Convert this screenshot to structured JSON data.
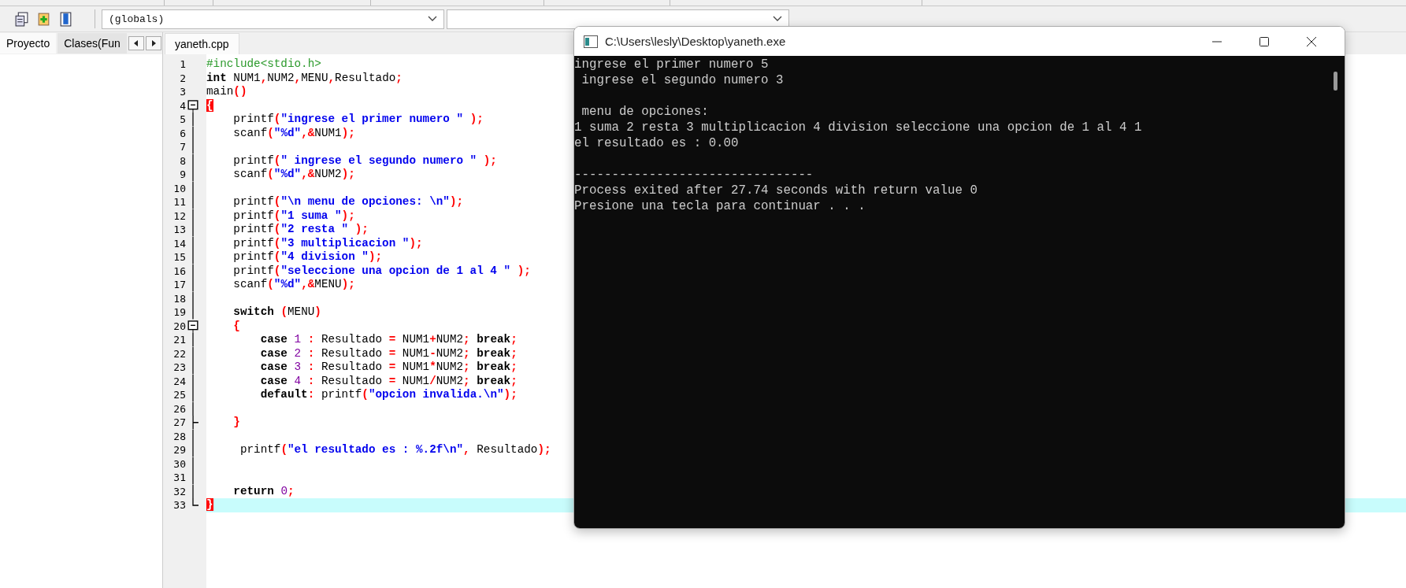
{
  "toolbar": {
    "scope_dropdown": {
      "value": "(globals)"
    }
  },
  "side_tabs": [
    {
      "label": "Proyecto",
      "selected": true
    },
    {
      "label": "Clases(Fun",
      "selected": false
    }
  ],
  "editor": {
    "tabs": [
      {
        "label": "yaneth.cpp",
        "selected": true
      }
    ],
    "lines": [
      {
        "number": "1",
        "current": false,
        "tokens": [
          {
            "kind": "preprocessor",
            "text": "#include<stdio.h>"
          }
        ]
      },
      {
        "number": "2",
        "current": false,
        "tokens": [
          {
            "kind": "keyword",
            "text": "int"
          },
          {
            "kind": "plain",
            "text": " NUM1"
          },
          {
            "kind": "symbol",
            "text": ","
          },
          {
            "kind": "plain",
            "text": "NUM2"
          },
          {
            "kind": "symbol",
            "text": ","
          },
          {
            "kind": "plain",
            "text": "MENU"
          },
          {
            "kind": "symbol",
            "text": ","
          },
          {
            "kind": "plain",
            "text": "Resultado"
          },
          {
            "kind": "symbol",
            "text": ";"
          }
        ]
      },
      {
        "number": "3",
        "current": false,
        "tokens": [
          {
            "kind": "plain",
            "text": "main"
          },
          {
            "kind": "symbol",
            "text": "()"
          }
        ]
      },
      {
        "number": "4",
        "current": false,
        "kind": "fold_start",
        "tokens": [
          {
            "kind": "brace_match",
            "text": "{"
          }
        ]
      },
      {
        "number": "5",
        "current": false,
        "tokens": [
          {
            "kind": "plain",
            "text": "    printf"
          },
          {
            "kind": "symbol",
            "text": "("
          },
          {
            "kind": "string",
            "text": "\"ingrese el primer numero \""
          },
          {
            "kind": "symbol",
            "text": " );"
          }
        ]
      },
      {
        "number": "6",
        "current": false,
        "tokens": [
          {
            "kind": "plain",
            "text": "    scanf"
          },
          {
            "kind": "symbol",
            "text": "("
          },
          {
            "kind": "string",
            "text": "\"%d\""
          },
          {
            "kind": "symbol",
            "text": ",&"
          },
          {
            "kind": "plain",
            "text": "NUM1"
          },
          {
            "kind": "symbol",
            "text": ");"
          }
        ]
      },
      {
        "number": "7",
        "current": false
      },
      {
        "number": "8",
        "current": false,
        "tokens": [
          {
            "kind": "plain",
            "text": "    printf"
          },
          {
            "kind": "symbol",
            "text": "("
          },
          {
            "kind": "string",
            "text": "\" ingrese el segundo numero \""
          },
          {
            "kind": "symbol",
            "text": " );"
          }
        ]
      },
      {
        "number": "9",
        "current": false,
        "tokens": [
          {
            "kind": "plain",
            "text": "    scanf"
          },
          {
            "kind": "symbol",
            "text": "("
          },
          {
            "kind": "string",
            "text": "\"%d\""
          },
          {
            "kind": "symbol",
            "text": ",&"
          },
          {
            "kind": "plain",
            "text": "NUM2"
          },
          {
            "kind": "symbol",
            "text": ");"
          }
        ]
      },
      {
        "number": "10",
        "current": false
      },
      {
        "number": "11",
        "current": false,
        "tokens": [
          {
            "kind": "plain",
            "text": "    printf"
          },
          {
            "kind": "symbol",
            "text": "("
          },
          {
            "kind": "string",
            "text": "\"\\n menu de opciones: \\n\""
          },
          {
            "kind": "symbol",
            "text": ");"
          }
        ]
      },
      {
        "number": "12",
        "current": false,
        "tokens": [
          {
            "kind": "plain",
            "text": "    printf"
          },
          {
            "kind": "symbol",
            "text": "("
          },
          {
            "kind": "string",
            "text": "\"1 suma \""
          },
          {
            "kind": "symbol",
            "text": ");"
          }
        ]
      },
      {
        "number": "13",
        "current": false,
        "tokens": [
          {
            "kind": "plain",
            "text": "    printf"
          },
          {
            "kind": "symbol",
            "text": "("
          },
          {
            "kind": "string",
            "text": "\"2 resta \""
          },
          {
            "kind": "symbol",
            "text": " );"
          }
        ]
      },
      {
        "number": "14",
        "current": false,
        "tokens": [
          {
            "kind": "plain",
            "text": "    printf"
          },
          {
            "kind": "symbol",
            "text": "("
          },
          {
            "kind": "string",
            "text": "\"3 multiplicacion \""
          },
          {
            "kind": "symbol",
            "text": ");"
          }
        ]
      },
      {
        "number": "15",
        "current": false,
        "tokens": [
          {
            "kind": "plain",
            "text": "    printf"
          },
          {
            "kind": "symbol",
            "text": "("
          },
          {
            "kind": "string",
            "text": "\"4 division \""
          },
          {
            "kind": "symbol",
            "text": ");"
          }
        ]
      },
      {
        "number": "16",
        "current": false,
        "tokens": [
          {
            "kind": "plain",
            "text": "    printf"
          },
          {
            "kind": "symbol",
            "text": "("
          },
          {
            "kind": "string",
            "text": "\"seleccione una opcion de 1 al 4 \""
          },
          {
            "kind": "symbol",
            "text": " );"
          }
        ]
      },
      {
        "number": "17",
        "current": false,
        "tokens": [
          {
            "kind": "plain",
            "text": "    scanf"
          },
          {
            "kind": "symbol",
            "text": "("
          },
          {
            "kind": "string",
            "text": "\"%d\""
          },
          {
            "kind": "symbol",
            "text": ",&"
          },
          {
            "kind": "plain",
            "text": "MENU"
          },
          {
            "kind": "symbol",
            "text": ");"
          }
        ]
      },
      {
        "number": "18",
        "current": false
      },
      {
        "number": "19",
        "current": false,
        "tokens": [
          {
            "kind": "keyword",
            "text": "    switch "
          },
          {
            "kind": "symbol",
            "text": "("
          },
          {
            "kind": "plain",
            "text": "MENU"
          },
          {
            "kind": "symbol",
            "text": ")"
          }
        ]
      },
      {
        "number": "20",
        "current": false,
        "kind": "fold_start",
        "tokens": [
          {
            "kind": "symbol",
            "text": "    {"
          }
        ]
      },
      {
        "number": "21",
        "current": false,
        "tokens": [
          {
            "kind": "keyword",
            "text": "        case"
          },
          {
            "kind": "number",
            "text": " 1"
          },
          {
            "kind": "symbol",
            "text": " :"
          },
          {
            "kind": "plain",
            "text": " Resultado "
          },
          {
            "kind": "symbol",
            "text": "="
          },
          {
            "kind": "plain",
            "text": " NUM1"
          },
          {
            "kind": "symbol",
            "text": "+"
          },
          {
            "kind": "plain",
            "text": "NUM2"
          },
          {
            "kind": "symbol",
            "text": ";"
          },
          {
            "kind": "keyword",
            "text": " break"
          },
          {
            "kind": "symbol",
            "text": ";"
          }
        ]
      },
      {
        "number": "22",
        "current": false,
        "tokens": [
          {
            "kind": "keyword",
            "text": "        case"
          },
          {
            "kind": "number",
            "text": " 2"
          },
          {
            "kind": "symbol",
            "text": " :"
          },
          {
            "kind": "plain",
            "text": " Resultado "
          },
          {
            "kind": "symbol",
            "text": "="
          },
          {
            "kind": "plain",
            "text": " NUM1"
          },
          {
            "kind": "symbol",
            "text": "-"
          },
          {
            "kind": "plain",
            "text": "NUM2"
          },
          {
            "kind": "symbol",
            "text": ";"
          },
          {
            "kind": "keyword",
            "text": " break"
          },
          {
            "kind": "symbol",
            "text": ";"
          }
        ]
      },
      {
        "number": "23",
        "current": false,
        "tokens": [
          {
            "kind": "keyword",
            "text": "        case"
          },
          {
            "kind": "number",
            "text": " 3"
          },
          {
            "kind": "symbol",
            "text": " :"
          },
          {
            "kind": "plain",
            "text": " Resultado "
          },
          {
            "kind": "symbol",
            "text": "="
          },
          {
            "kind": "plain",
            "text": " NUM1"
          },
          {
            "kind": "symbol",
            "text": "*"
          },
          {
            "kind": "plain",
            "text": "NUM2"
          },
          {
            "kind": "symbol",
            "text": ";"
          },
          {
            "kind": "keyword",
            "text": " break"
          },
          {
            "kind": "symbol",
            "text": ";"
          }
        ]
      },
      {
        "number": "24",
        "current": false,
        "tokens": [
          {
            "kind": "keyword",
            "text": "        case"
          },
          {
            "kind": "number",
            "text": " 4"
          },
          {
            "kind": "symbol",
            "text": " :"
          },
          {
            "kind": "plain",
            "text": " Resultado "
          },
          {
            "kind": "symbol",
            "text": "="
          },
          {
            "kind": "plain",
            "text": " NUM1"
          },
          {
            "kind": "symbol",
            "text": "/"
          },
          {
            "kind": "plain",
            "text": "NUM2"
          },
          {
            "kind": "symbol",
            "text": ";"
          },
          {
            "kind": "keyword",
            "text": " break"
          },
          {
            "kind": "symbol",
            "text": ";"
          }
        ]
      },
      {
        "number": "25",
        "current": false,
        "tokens": [
          {
            "kind": "keyword",
            "text": "        default"
          },
          {
            "kind": "symbol",
            "text": ":"
          },
          {
            "kind": "plain",
            "text": " printf"
          },
          {
            "kind": "symbol",
            "text": "("
          },
          {
            "kind": "string",
            "text": "\"opcion invalida.\\n\""
          },
          {
            "kind": "symbol",
            "text": ");"
          }
        ]
      },
      {
        "number": "26",
        "current": false
      },
      {
        "number": "27",
        "current": false,
        "kind": "fold_close",
        "tokens": [
          {
            "kind": "symbol",
            "text": "    }"
          }
        ]
      },
      {
        "number": "28",
        "current": false
      },
      {
        "number": "29",
        "current": false,
        "tokens": [
          {
            "kind": "plain",
            "text": "     printf"
          },
          {
            "kind": "symbol",
            "text": "("
          },
          {
            "kind": "string",
            "text": "\"el resultado es : %.2f\\n\""
          },
          {
            "kind": "symbol",
            "text": ","
          },
          {
            "kind": "plain",
            "text": " Resultado"
          },
          {
            "kind": "symbol",
            "text": ");"
          }
        ]
      },
      {
        "number": "30",
        "current": false
      },
      {
        "number": "31",
        "current": false
      },
      {
        "number": "32",
        "current": false,
        "tokens": [
          {
            "kind": "keyword",
            "text": "    return"
          },
          {
            "kind": "number",
            "text": " 0"
          },
          {
            "kind": "symbol",
            "text": ";"
          }
        ]
      },
      {
        "number": "33",
        "current": true,
        "kind": "fold_end",
        "tokens": [
          {
            "kind": "brace_match",
            "text": "}"
          }
        ]
      }
    ]
  },
  "console_window": {
    "title": "C:\\Users\\lesly\\Desktop\\yaneth.exe",
    "output_blocks": [
      [
        "ingrese el primer numero 5",
        " ingrese el segundo numero 3"
      ],
      [
        " menu de opciones:",
        "1 suma 2 resta 3 multiplicacion 4 division seleccione una opcion de 1 al 4 1",
        "el resultado es : 0.00"
      ],
      [
        "--------------------------------",
        "Process exited after 27.74 seconds with return value 0",
        "Presione una tecla para continuar . . ."
      ]
    ]
  }
}
